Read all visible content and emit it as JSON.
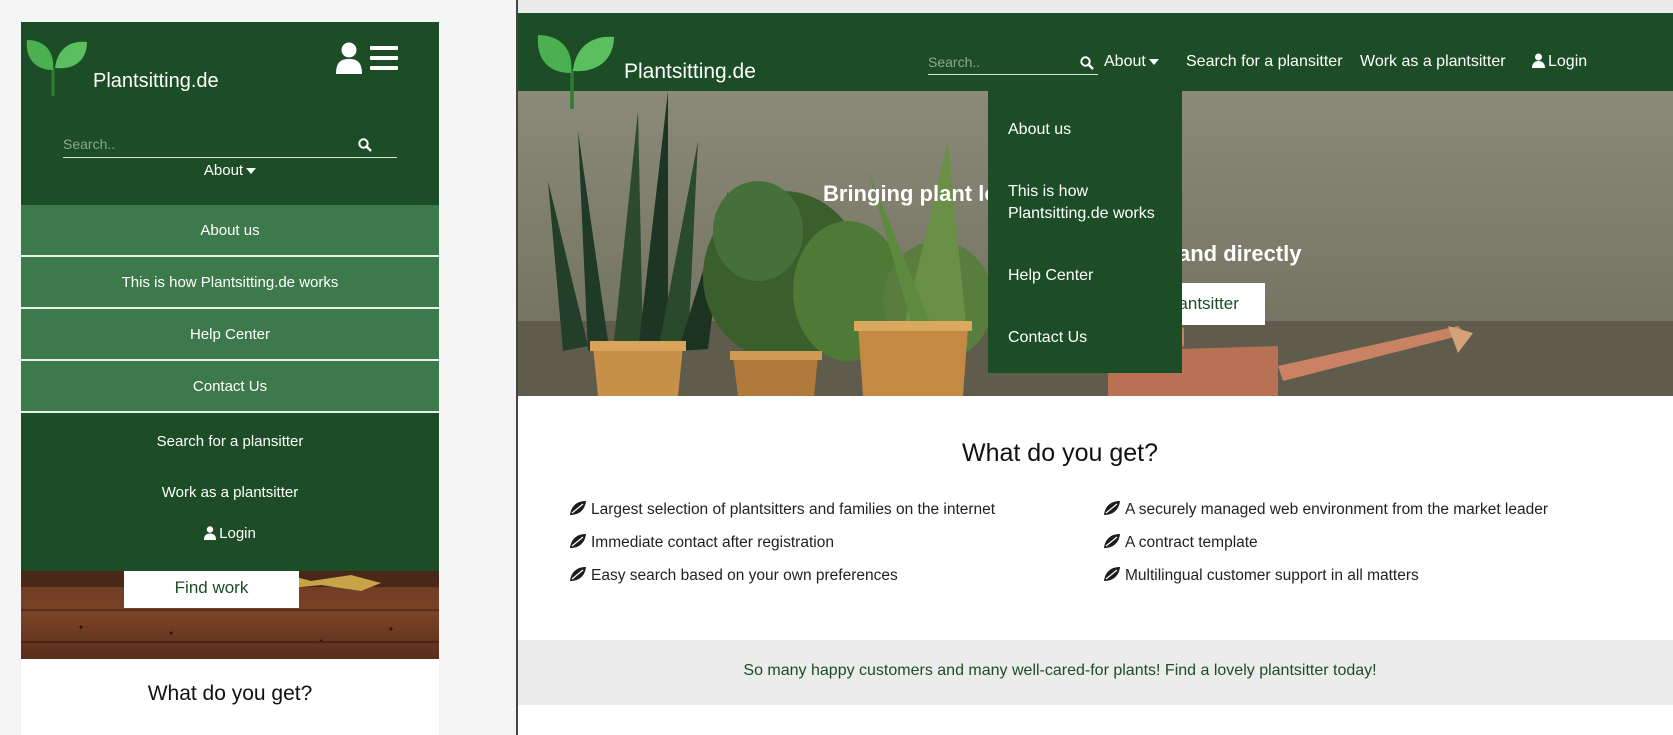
{
  "brand": {
    "name": "Plantsitting.de",
    "primary_color": "#1c4d26",
    "accent_color": "#3d7a4b",
    "leaf_color": "#4caf50"
  },
  "search": {
    "placeholder": "Search.."
  },
  "nav": {
    "about_label": "About",
    "search_plansitter_label": "Search for a plansitter",
    "work_plantsitter_label": "Work as a plantsitter",
    "login_label": "Login"
  },
  "about_menu": {
    "items": [
      {
        "label": "About us"
      },
      {
        "label": "This is how Plantsitting.de works"
      },
      {
        "label": "Help Center"
      },
      {
        "label": "Contact Us"
      }
    ]
  },
  "mobile": {
    "find_work_label": "Find work",
    "section_title": "What do you get?"
  },
  "desktop": {
    "hero_line1": "Bringing plant lo                    rs together",
    "hero_line2": "and directly",
    "hero_button": "g plantsitter",
    "section_title": "What do you get?",
    "features_left": [
      "Largest selection of plantsitters and families on the internet",
      "Immediate contact after registration",
      "Easy search based on your own preferences"
    ],
    "features_right": [
      "A securely managed web environment from the market leader",
      "A contract template",
      "Multilingual customer support in all matters"
    ],
    "banner_text": "So many happy customers and many well-cared-for plants! Find a lovely plantsitter today!"
  },
  "icons": {
    "logo": "leaf-sprout-icon",
    "user": "user-icon",
    "menu": "hamburger-menu-icon",
    "search": "search-icon",
    "caret": "caret-down-icon",
    "feature_bullet": "leaf-icon"
  }
}
